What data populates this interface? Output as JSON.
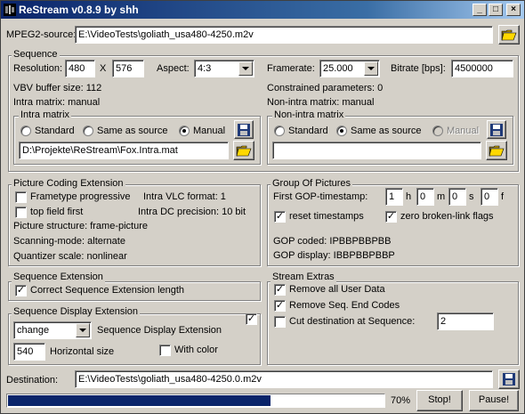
{
  "window": {
    "title": "ReStream v0.8.9 by shh"
  },
  "colors": {
    "title_bar": "#0a246a",
    "progress": "#0a246a",
    "face": "#d4d0c8"
  },
  "source": {
    "label": "MPEG2-source:",
    "path": "E:\\VideoTests\\goliath_usa480-4250.m2v",
    "open_icon": "folder-open-icon"
  },
  "sequence": {
    "title": "Sequence",
    "resolution_label": "Resolution:",
    "width": "480",
    "x_label": "X",
    "height": "576",
    "aspect_label": "Aspect:",
    "aspect": "4:3",
    "framerate_label": "Framerate:",
    "framerate": "25.000",
    "bitrate_label": "Bitrate [bps]:",
    "bitrate": "4500000",
    "vbv": "VBV buffer size: 112",
    "constrained": "Constrained parameters: 0",
    "intra_matrix_info": "Intra matrix: manual",
    "nonintra_matrix_info": "Non-intra matrix: manual",
    "intra": {
      "title": "Intra matrix",
      "standard": "Standard",
      "same": "Same as source",
      "manual": "Manual",
      "selected": "manual",
      "path": "D:\\Projekte\\ReStream\\Fox.Intra.mat"
    },
    "nonintra": {
      "title": "Non-intra matrix",
      "standard": "Standard",
      "same": "Same as source",
      "manual": "Manual",
      "selected": "same",
      "path": ""
    }
  },
  "pce": {
    "title": "Picture Coding Extension",
    "frametype": "Frametype progressive",
    "frametype_checked": false,
    "intra_vlc": "Intra VLC format: 1",
    "top_field": "top field first",
    "top_field_checked": false,
    "intra_dc": "Intra DC precision: 10 bit",
    "structure": "Picture structure: frame-picture",
    "scanning": "Scanning-mode: alternate",
    "quantizer": "Quantizer scale: nonlinear"
  },
  "gop": {
    "title": "Group Of Pictures",
    "first_label": "First GOP-timestamp:",
    "h": "1",
    "h_unit": "h",
    "m": "0",
    "m_unit": "m",
    "s": "0",
    "s_unit": "s",
    "f": "0",
    "f_unit": "f",
    "reset": "reset timestamps",
    "reset_checked": true,
    "zero": "zero broken-link flags",
    "zero_checked": true,
    "coded": "GOP coded: IPBBPBBPBB",
    "display": "GOP display: IBBPBBPBBP"
  },
  "seqext": {
    "title": "Sequence Extension",
    "correct": "Correct Sequence Extension length",
    "correct_checked": true
  },
  "seqdisp": {
    "title": "Sequence Display Extension",
    "mode": "change",
    "label": "Sequence Display Extension",
    "enabled_checked": true,
    "hsize": "540",
    "hsize_label": "Horizontal size",
    "color": "With color",
    "color_checked": false
  },
  "extras": {
    "title": "Stream Extras",
    "remove_user": "Remove all User Data",
    "remove_user_checked": true,
    "remove_end": "Remove Seq. End Codes",
    "remove_end_checked": true,
    "cut": "Cut destination at Sequence:",
    "cut_checked": false,
    "cut_value": "2"
  },
  "destination": {
    "label": "Destination:",
    "path": "E:\\VideoTests\\goliath_usa480-4250.0.m2v",
    "save_icon": "floppy-disk-icon"
  },
  "progress": {
    "value": 0.7,
    "label": "70%"
  },
  "buttons": {
    "stop": "Stop!",
    "pause": "Pause!"
  }
}
